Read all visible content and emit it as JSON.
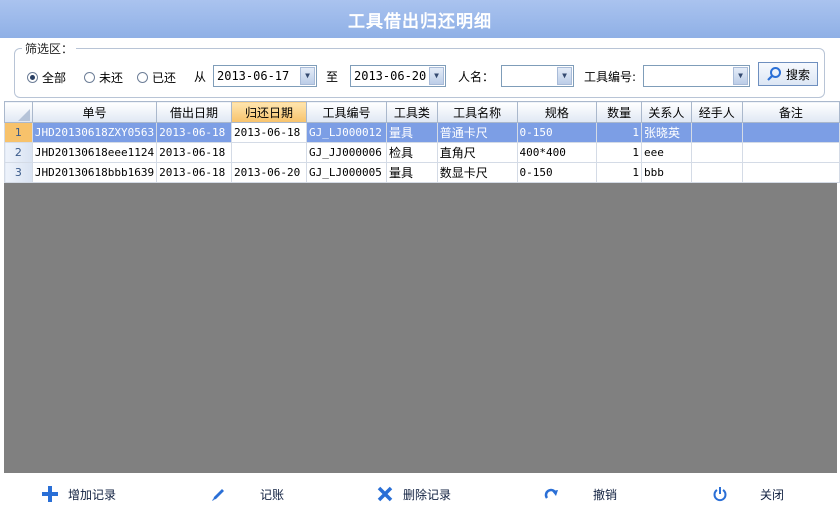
{
  "window": {
    "title": "工具借出归还明细"
  },
  "filter": {
    "legend": "筛选区：",
    "radios": [
      {
        "label": "全部",
        "checked": true
      },
      {
        "label": "未还",
        "checked": false
      },
      {
        "label": "已还",
        "checked": false
      }
    ],
    "from_label": "从",
    "from_date": "2013-06-17",
    "to_label": "至",
    "to_date": "2013-06-20",
    "person_label": "人名：",
    "person_value": "",
    "tool_no_label": "工具编号:",
    "tool_no_value": "",
    "search_label": "搜索"
  },
  "grid": {
    "columns": [
      "单号",
      "借出日期",
      "归还日期",
      "工具编号",
      "工具类",
      "工具名称",
      "规格",
      "数量",
      "关系人",
      "经手人",
      "备注"
    ],
    "sorted_column": "归还日期",
    "rows": [
      {
        "num": "1",
        "cells": [
          "JHD20130618ZXY0563",
          "2013-06-18",
          "2013-06-18",
          "GJ_LJ000012",
          "量具",
          "普通卡尺",
          "0-150",
          "1",
          "张晓英",
          "",
          ""
        ]
      },
      {
        "num": "2",
        "cells": [
          "JHD20130618eee1124",
          "2013-06-18",
          "",
          "GJ_JJ000006",
          "检具",
          "直角尺",
          "400*400",
          "1",
          "eee",
          "",
          ""
        ]
      },
      {
        "num": "3",
        "cells": [
          "JHD20130618bbb1639",
          "2013-06-18",
          "2013-06-20",
          "GJ_LJ000005",
          "量具",
          "数显卡尺",
          "0-150",
          "1",
          "bbb",
          "",
          ""
        ]
      }
    ]
  },
  "toolbar": {
    "add_label": "增加记录",
    "post_label": "记账",
    "delete_label": "删除记录",
    "undo_label": "撤销",
    "close_label": "关闭"
  },
  "colors": {
    "title_bar": "#9ab6ea",
    "selected_row": "#7c9ee5",
    "sorted_header": "#f7c26b",
    "empty_grid": "#808080",
    "icon_blue": "#2a6fd6"
  },
  "icons": [
    "search-icon",
    "plus-icon",
    "pencil-icon",
    "x-icon",
    "redo-icon",
    "power-icon",
    "chevron-down-icon"
  ]
}
